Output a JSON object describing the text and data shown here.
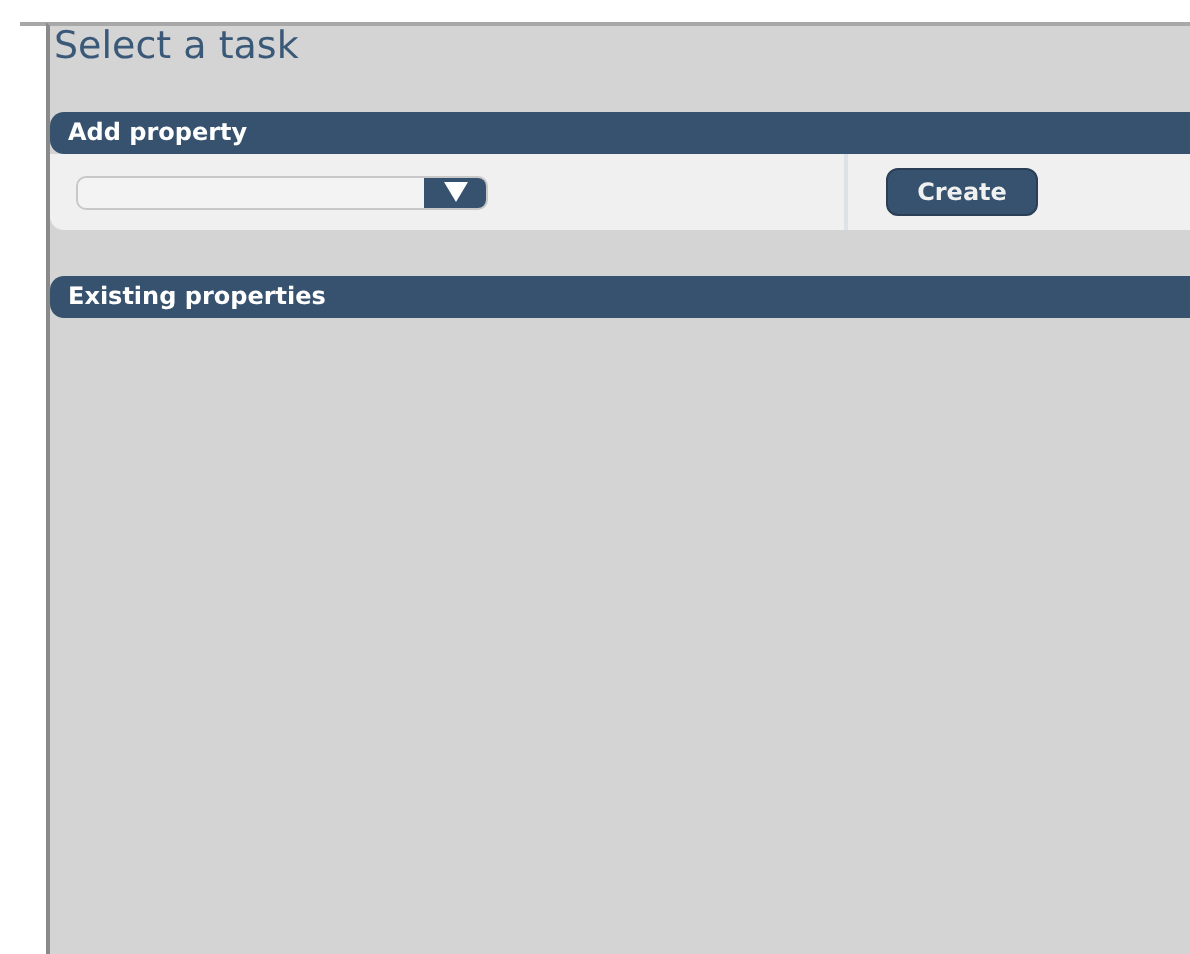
{
  "title": "Select a task",
  "sections": [
    {
      "title": "Add property",
      "dropdown": {
        "kind": "select"
      },
      "button": "Create"
    },
    {
      "title": "Existing properties"
    }
  ]
}
